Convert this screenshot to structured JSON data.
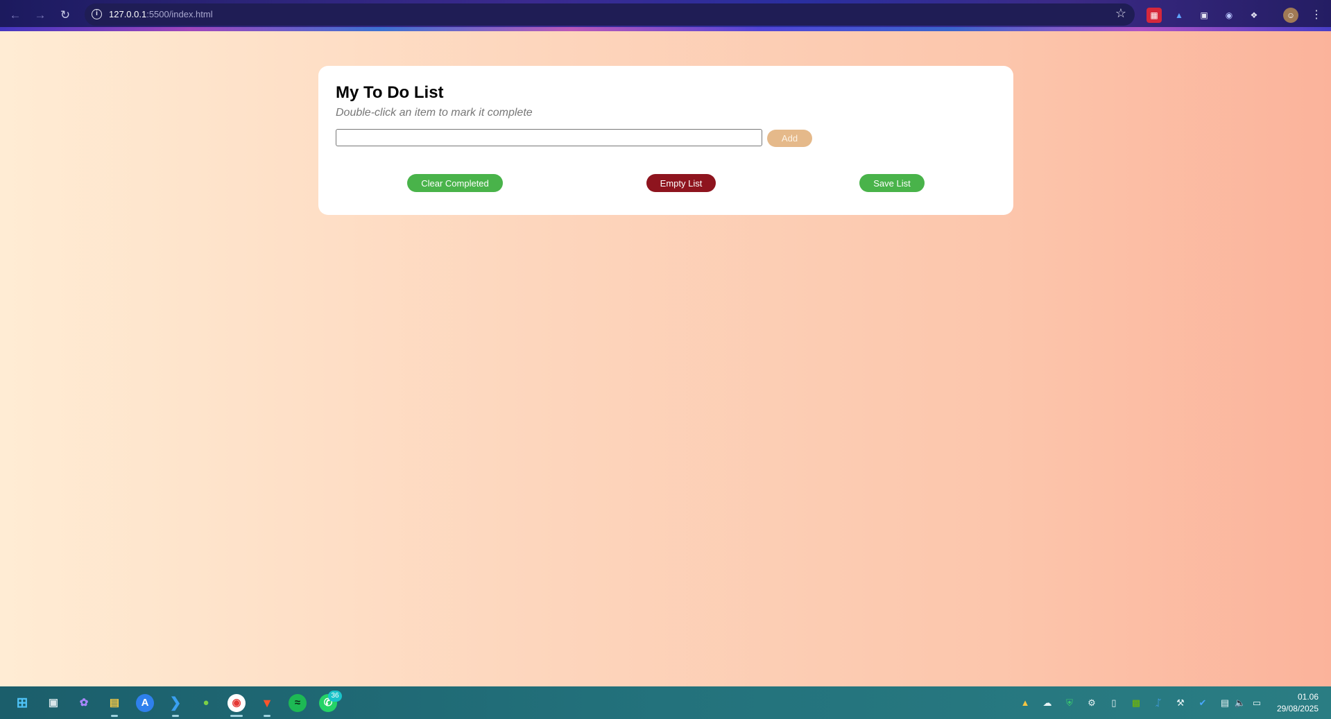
{
  "browser": {
    "url_host": "127.0.0.1",
    "url_path": ":5500/index.html"
  },
  "app": {
    "title": "My To Do List",
    "subtitle": "Double-click an item to mark it complete",
    "input_value": "",
    "add_label": "Add",
    "buttons": {
      "clear_completed": "Clear Completed",
      "empty_list": "Empty List",
      "save_list": "Save List"
    },
    "colors": {
      "green": "#49b34a",
      "red": "#8e141e",
      "add": "#e5b98a"
    }
  },
  "taskbar": {
    "whatsapp_badge": "36",
    "time": "01.06",
    "date": "29/08/2025"
  }
}
